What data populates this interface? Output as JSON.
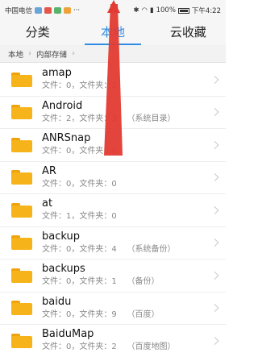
{
  "statusbar": {
    "carrier": "中国电信",
    "right_text": "100%",
    "time": "下午4:22",
    "icons": [
      "cloud-icon",
      "app-icon-red",
      "app-icon-green",
      "app-icon-orange",
      "more-dots-icon"
    ]
  },
  "tabs": [
    {
      "label": "分类",
      "active": false
    },
    {
      "label": "本地",
      "active": true
    },
    {
      "label": "云收藏",
      "active": false
    }
  ],
  "breadcrumb": [
    "本地",
    "内部存储"
  ],
  "items": [
    {
      "name": "amap",
      "meta": "文件：0，文件夹：2"
    },
    {
      "name": "Android",
      "meta": "文件：2，文件夹：3    （系统目录）"
    },
    {
      "name": "ANRSnap",
      "meta": "文件：0，文件夹：0"
    },
    {
      "name": "AR",
      "meta": "文件：0，文件夹：0"
    },
    {
      "name": "at",
      "meta": "文件：1，文件夹：0"
    },
    {
      "name": "backup",
      "meta": "文件：0，文件夹：4    （系统备份）"
    },
    {
      "name": "backups",
      "meta": "文件：0，文件夹：1    （备份）"
    },
    {
      "name": "baidu",
      "meta": "文件：0，文件夹：9    （百度）"
    },
    {
      "name": "BaiduMap",
      "meta": "文件：0，文件夹：2    （百度地图）"
    }
  ],
  "colors": {
    "accent": "#2f8de4",
    "folder": "#f6b41a",
    "annotation_arrow": "#e23b33"
  }
}
